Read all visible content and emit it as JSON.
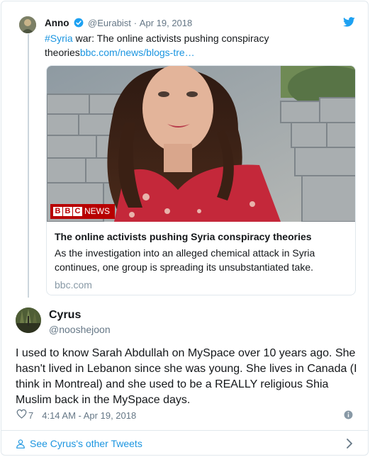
{
  "quoted_tweet": {
    "author_name": "Anno",
    "handle": "@Eurabist",
    "separator": "·",
    "date": "Apr 19, 2018",
    "hashtag": "#Syria",
    "text": " war: The online activists pushing conspiracy theories",
    "link": "bbc.com/news/blogs-tre…",
    "icons": [
      "verified-icon",
      "twitter-bird-icon"
    ]
  },
  "link_card": {
    "brand_letters": [
      "B",
      "B",
      "C"
    ],
    "brand_word": "NEWS",
    "title": "The online activists pushing Syria conspiracy theories",
    "description": "As the investigation into an alleged chemical attack in Syria continues, one group is spreading its unsubstantiated take.",
    "domain": "bbc.com"
  },
  "tweet": {
    "author_name": "Cyrus",
    "handle": "@nooshejoon",
    "text": "I used to know Sarah Abdullah on MySpace over 10 years ago. She hasn't lived in Lebanon since she was young. She lives in Canada (I think in Montreal) and she used to be a REALLY religious Shia Muslim back in the MySpace days.",
    "like_count": "7",
    "timestamp": "4:14 AM - Apr 19, 2018",
    "icons": [
      "heart-icon",
      "info-icon"
    ]
  },
  "footer": {
    "see_more_label": "See Cyrus's other Tweets",
    "icons": [
      "person-icon",
      "chevron-right-icon"
    ]
  },
  "colors": {
    "link_blue": "#1b95e0",
    "secondary_text": "#657786",
    "border": "#e1e8ed",
    "bbc_red": "#b80000"
  }
}
